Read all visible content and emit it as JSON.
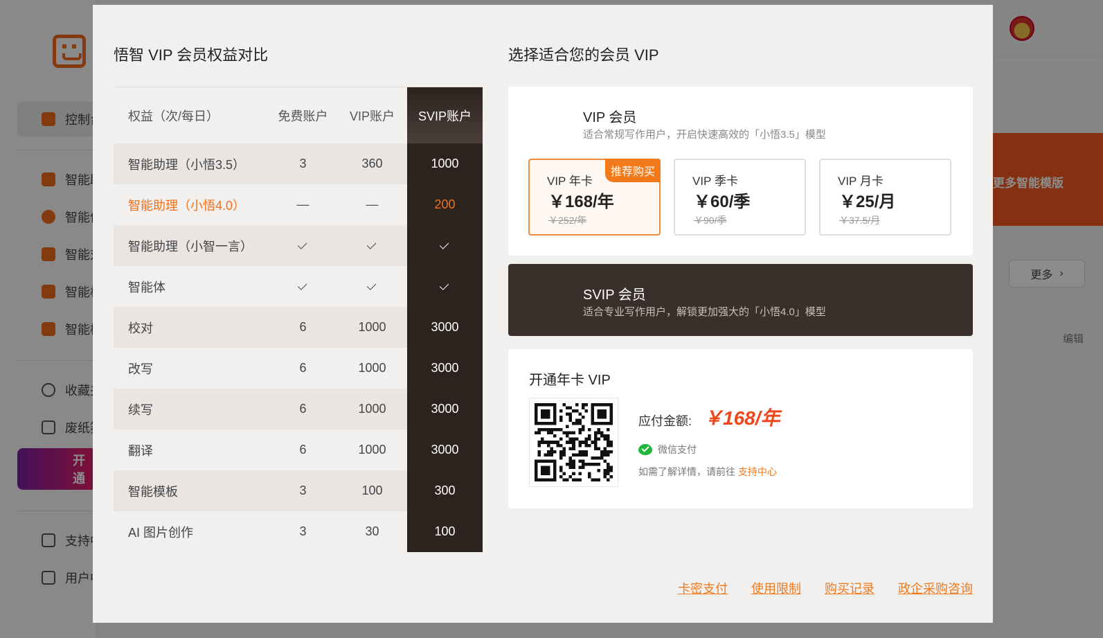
{
  "background": {
    "nav_items": [
      "控制台",
      "智能助理",
      "智能体",
      "智能对话",
      "智能校对",
      "智能模板",
      "收藏夹",
      "废纸篓",
      "支持中心",
      "用户中心"
    ],
    "open_label": "开通",
    "banner_text": "更多智能模版",
    "more_label": "更多",
    "edit_label": "编辑"
  },
  "modal": {
    "left_title": "悟智 VIP 会员权益对比",
    "right_title": "选择适合您的会员 VIP",
    "comparison": {
      "headers": {
        "benefit": "权益（次/每日）",
        "free": "免费账户",
        "vip": "VIP账户",
        "svip": "SVIP账户"
      },
      "rows": [
        {
          "name": "智能助理（小悟3.5）",
          "free": "3",
          "vip": "360",
          "svip": "1000"
        },
        {
          "name": "智能助理（小悟4.0）",
          "free": "—",
          "vip": "—",
          "svip": "200"
        },
        {
          "name": "智能助理（小智一言）",
          "free": "check",
          "vip": "check",
          "svip": "check"
        },
        {
          "name": "智能体",
          "free": "check",
          "vip": "check",
          "svip": "check"
        },
        {
          "name": "校对",
          "free": "6",
          "vip": "1000",
          "svip": "3000"
        },
        {
          "name": "改写",
          "free": "6",
          "vip": "1000",
          "svip": "3000"
        },
        {
          "name": "续写",
          "free": "6",
          "vip": "1000",
          "svip": "3000"
        },
        {
          "name": "翻译",
          "free": "6",
          "vip": "1000",
          "svip": "3000"
        },
        {
          "name": "智能模板",
          "free": "3",
          "vip": "100",
          "svip": "300"
        },
        {
          "name": "AI 图片创作",
          "free": "3",
          "vip": "30",
          "svip": "100"
        }
      ]
    },
    "vip": {
      "name": "VIP 会员",
      "desc": "适合常规写作用户，开启快速高效的「小悟3.5」模型",
      "plans": [
        {
          "name": "VIP 年卡",
          "price": "￥168/年",
          "original": "￥252/年",
          "badge": "推荐购买"
        },
        {
          "name": "VIP 季卡",
          "price": "￥60/季",
          "original": "￥90/季"
        },
        {
          "name": "VIP 月卡",
          "price": "￥25/月",
          "original": "￥37.5/月"
        }
      ]
    },
    "svip": {
      "name": "SVIP 会员",
      "desc": "适合专业写作用户，解锁更加强大的「小悟4.0」模型"
    },
    "payment": {
      "title": "开通年卡 VIP",
      "amount_label": "应付金额:",
      "amount": "￥168/年",
      "method": "微信支付",
      "help_text": "如需了解详情，请前往",
      "help_link": "支持中心"
    },
    "footer_links": [
      "卡密支付",
      "使用限制",
      "购买记录",
      "政企采购咨询"
    ]
  },
  "colors": {
    "accent": "#f07a1c",
    "svip_dark": "#2c221e",
    "price_red": "#f0461c",
    "wechat_green": "#1fb73a"
  }
}
